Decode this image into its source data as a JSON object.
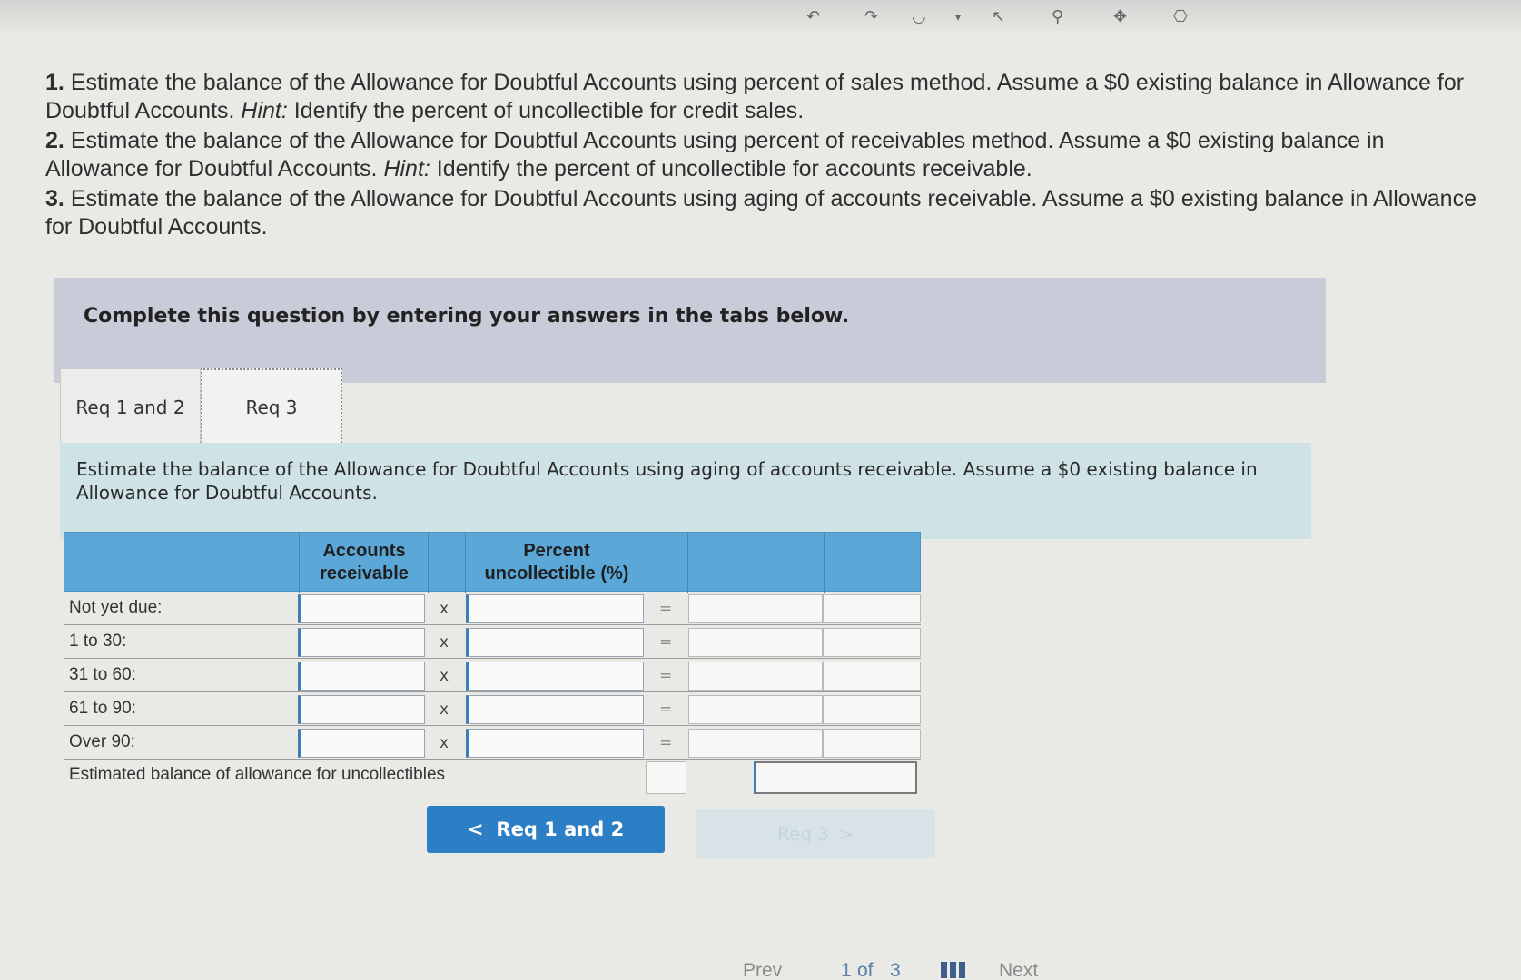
{
  "toolbar": {
    "icons": [
      "undo-icon",
      "redo-icon",
      "shape-icon",
      "pointer-icon",
      "link-icon",
      "move-icon",
      "fullscreen-icon"
    ],
    "glyphs": [
      "↶",
      "↷",
      "◡",
      "▾",
      "↖",
      "⚲",
      "✥",
      "⎔"
    ]
  },
  "instructions": {
    "q1_num": "1.",
    "q1_a": "Estimate the balance of the Allowance for Doubtful Accounts using percent of sales method. Assume a $0 existing balance in Allowance for Doubtful Accounts. ",
    "q1_hint": "Hint:",
    "q1_b": " Identify the percent of uncollectible for credit sales.",
    "q2_num": "2.",
    "q2_a": "Estimate the balance of the Allowance for Doubtful Accounts using percent of receivables method. Assume a $0 existing balance in Allowance for Doubtful Accounts. ",
    "q2_hint": "Hint:",
    "q2_b": " Identify the percent of uncollectible for accounts receivable.",
    "q3_num": "3.",
    "q3_a": "Estimate the balance of the Allowance for Doubtful Accounts using aging of accounts receivable. Assume a $0 existing balance in Allowance for Doubtful Accounts."
  },
  "question_bar": {
    "text": "Complete this question by entering your answers in the tabs below."
  },
  "tabs": [
    {
      "label": "Req 1 and 2"
    },
    {
      "label": "Req 3"
    }
  ],
  "panel": {
    "text": "Estimate the balance of the Allowance for Doubtful Accounts using aging of accounts receivable. Assume a $0 existing balance in Allowance for Doubtful Accounts."
  },
  "table": {
    "headers": {
      "accounts_receivable": "Accounts receivable",
      "percent_uncollectible": "Percent uncollectible (%)"
    },
    "rows": [
      {
        "label": "Not yet due:",
        "ar_value": "",
        "pct_value": "",
        "result": ""
      },
      {
        "label": "1 to 30:",
        "ar_value": "",
        "pct_value": "",
        "result": ""
      },
      {
        "label": "31 to 60:",
        "ar_value": "",
        "pct_value": "",
        "result": ""
      },
      {
        "label": "61 to 90:",
        "ar_value": "",
        "pct_value": "",
        "result": ""
      },
      {
        "label": "Over 90:",
        "ar_value": "",
        "pct_value": "",
        "result": ""
      }
    ],
    "multiply_symbol": "x",
    "equals_symbol": "=",
    "total_label": "Estimated balance of allowance for uncollectibles",
    "total_value": ""
  },
  "navigation": {
    "prev_tab_label": "Req 1 and 2",
    "prev_chevron": "<",
    "next_tab_label": "Req 3",
    "next_chevron": ">"
  },
  "pager": {
    "prev": "Prev",
    "current": "1",
    "of_text": "of",
    "total": "3",
    "next": "Next"
  }
}
